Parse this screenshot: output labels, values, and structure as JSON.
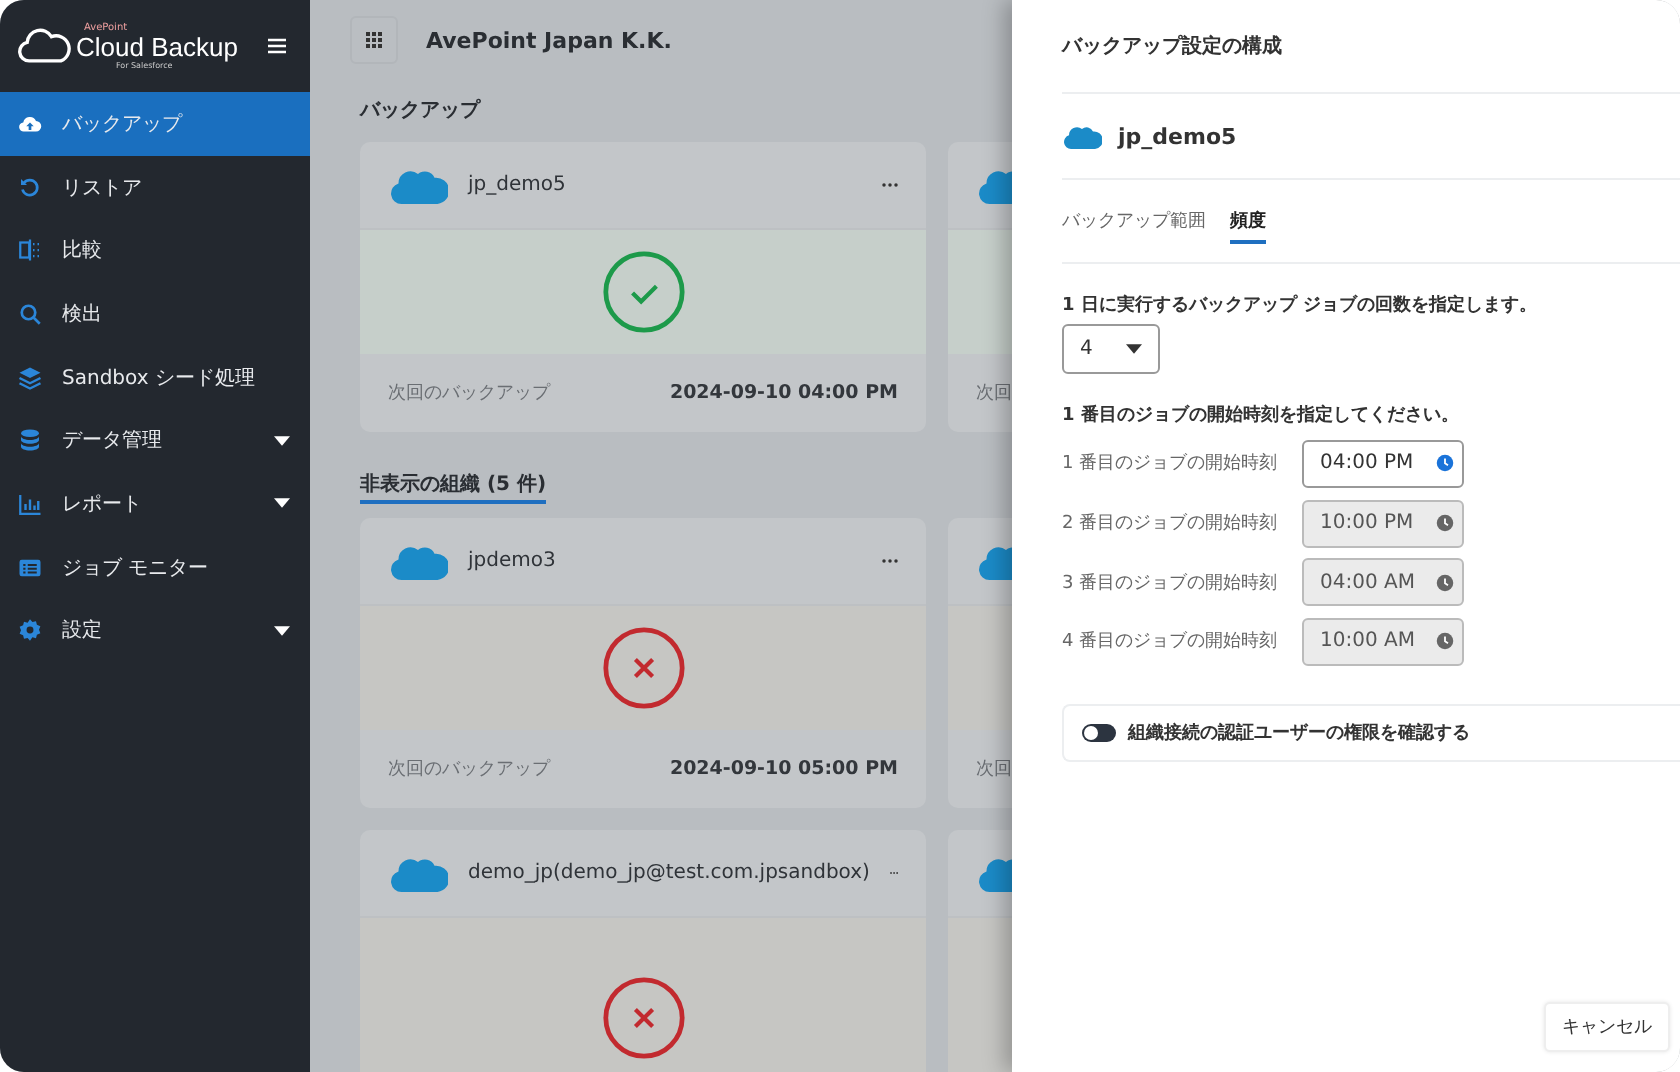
{
  "sidebar": {
    "logo": {
      "brand": "AvePoint",
      "title": "Cloud Backup",
      "subtitle": "For Salesforce"
    },
    "items": [
      {
        "label": "バックアップ",
        "kind": "cloud-upload",
        "selected": true,
        "expandable": false
      },
      {
        "label": "リストア",
        "kind": "restore",
        "selected": false,
        "expandable": false
      },
      {
        "label": "比較",
        "kind": "compare",
        "selected": false,
        "expandable": false
      },
      {
        "label": "検出",
        "kind": "search",
        "selected": false,
        "expandable": false
      },
      {
        "label": "Sandbox シード処理",
        "kind": "layers",
        "selected": false,
        "expandable": false
      },
      {
        "label": "データ管理",
        "kind": "database",
        "selected": false,
        "expandable": true
      },
      {
        "label": "レポート",
        "kind": "chart",
        "selected": false,
        "expandable": true
      },
      {
        "label": "ジョブ モニター",
        "kind": "list",
        "selected": false,
        "expandable": false
      },
      {
        "label": "設定",
        "kind": "gear",
        "selected": false,
        "expandable": true
      }
    ]
  },
  "header": {
    "org": "AvePoint Japan K.K."
  },
  "sections": [
    {
      "title": "バックアップ",
      "kind": "heading",
      "rows": [
        {
          "card": {
            "name": "jp_demo5",
            "kind": "success",
            "footer_label": "次回のバックアップ",
            "next_time": "2024-09-10 04:00 PM"
          },
          "peek": {
            "footer_label": "次回"
          }
        }
      ]
    },
    {
      "title": "非表示の組織 (5 件)",
      "kind": "link",
      "rows": [
        {
          "card": {
            "name": "jpdemo3",
            "kind": "error",
            "footer_label": "次回のバックアップ",
            "next_time": "2024-09-10 05:00 PM"
          },
          "peek": {
            "footer_label": "次回"
          }
        },
        {
          "card": {
            "name": "demo_jp(demo_jp@test.com.jpsandbox)",
            "kind": "error"
          },
          "peek": {}
        }
      ]
    }
  ],
  "panel": {
    "title": "バックアップ設定の構成",
    "org": "jp_demo5",
    "tabs": [
      {
        "label": "バックアップ範囲",
        "selected": false
      },
      {
        "label": "頻度",
        "selected": true
      }
    ],
    "count_label": "1 日に実行するバックアップ ジョブの回数を指定します。",
    "count_value": "4",
    "times_label": "1 番目のジョブの開始時刻を指定してください。",
    "times": [
      {
        "label": "1 番目のジョブの開始時刻",
        "value": "04:00 PM",
        "disabled": false
      },
      {
        "label": "2 番目のジョブの開始時刻",
        "value": "10:00 PM",
        "disabled": true
      },
      {
        "label": "3 番目のジョブの開始時刻",
        "value": "04:00 AM",
        "disabled": true
      },
      {
        "label": "4 番目のジョブの開始時刻",
        "value": "10:00 AM",
        "disabled": true
      }
    ],
    "toggle": {
      "label": "組織接続の認証ユーザーの権限を確認する",
      "on": false
    },
    "cancel": "キャンセル"
  }
}
